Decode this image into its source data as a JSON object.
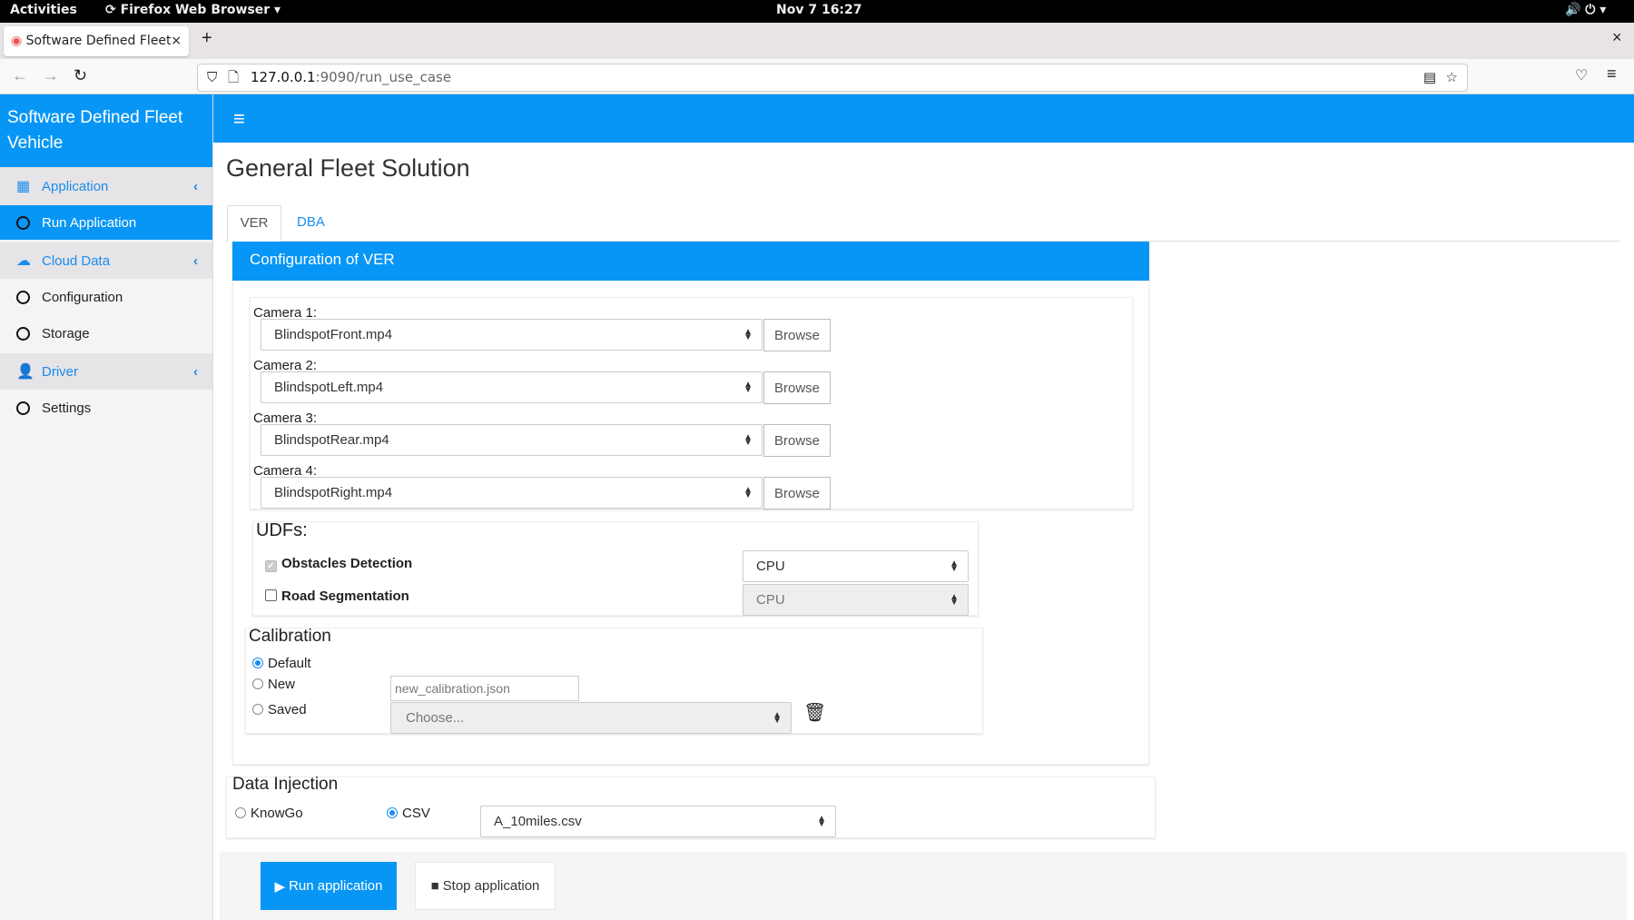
{
  "os": {
    "activities": "Activities",
    "app": "Firefox Web Browser",
    "clock": "Nov 7  16:27"
  },
  "browser": {
    "tab_title": "Software Defined Fleet",
    "url_host": "127.0.0.1",
    "url_path": ":9090/run_use_case"
  },
  "sidebar": {
    "title": "Software Defined Fleet Vehicle",
    "items": [
      {
        "label": "Application"
      },
      {
        "label": "Run Application"
      },
      {
        "label": "Cloud Data"
      },
      {
        "label": "Configuration"
      },
      {
        "label": "Storage"
      },
      {
        "label": "Driver"
      },
      {
        "label": "Settings"
      }
    ]
  },
  "header": {
    "menu_icon": "≡"
  },
  "page": {
    "title": "General Fleet Solution",
    "tabs": [
      {
        "label": "VER"
      },
      {
        "label": "DBA"
      }
    ]
  },
  "card": {
    "title": "Configuration of VER",
    "cameras": [
      {
        "label": "Camera 1:",
        "value": "BlindspotFront.mp4",
        "browse": "Browse"
      },
      {
        "label": "Camera 2:",
        "value": "BlindspotLeft.mp4",
        "browse": "Browse"
      },
      {
        "label": "Camera 3:",
        "value": "BlindspotRear.mp4",
        "browse": "Browse"
      },
      {
        "label": "Camera 4:",
        "value": "BlindspotRight.mp4",
        "browse": "Browse"
      }
    ],
    "udfs": {
      "title": "UDFs:",
      "items": [
        {
          "label": "Obstacles Detection",
          "checked": true,
          "device": "CPU"
        },
        {
          "label": "Road Segmentation",
          "checked": false,
          "device": "CPU"
        }
      ]
    },
    "calibration": {
      "title": "Calibration",
      "default": "Default",
      "new": "New",
      "saved": "Saved",
      "new_placeholder": "new_calibration.json",
      "saved_placeholder": "Choose..."
    }
  },
  "injection": {
    "title": "Data Injection",
    "knowgo": "KnowGo",
    "csv": "CSV",
    "csv_value": "A_10miles.csv"
  },
  "actions": {
    "run": "Run application",
    "stop": "Stop application"
  },
  "colors": {
    "primary": "#0796f5"
  }
}
